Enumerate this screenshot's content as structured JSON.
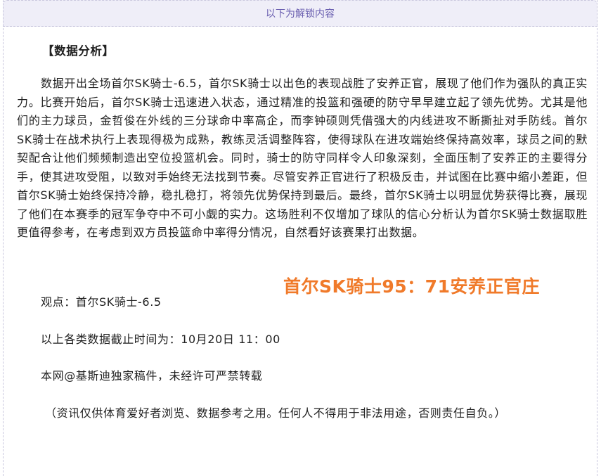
{
  "unlock_banner": {
    "text": "以下为解锁内容"
  },
  "article": {
    "heading": "【数据分析】",
    "body": "数据开出全场首尔SK骑士-6.5，首尔SK骑士以出色的表现战胜了安养正官，展现了他们作为强队的真正实力。比赛开始后，首尔SK骑士迅速进入状态，通过精准的投篮和强硬的防守早早建立起了领先优势。尤其是他们的主力球员，金哲俊在外线的三分球命中率高企，而李钟硕则凭借强大的内线进攻不断撕扯对手防线。首尔SK骑士在战术执行上表现得极为成熟，教练灵活调整阵容，使得球队在进攻端始终保持高效率，球员之间的默契配合让他们频频制造出空位投篮机会。同时，骑士的防守同样令人印象深刻，全面压制了安养正的主要得分手，使其进攻受阻，以致对手始终无法找到节奏。尽管安养正官进行了积极反击，并试图在比赛中缩小差距，但首尔SK骑士始终保持冷静，稳扎稳打，将领先优势保持到最后。最终，首尔SK骑士以明显优势获得比赛，展现了他们在本赛季的冠军争夺中不可小觑的实力。这场胜利不仅增加了球队的信心分析认为首尔SK骑士数据取胜更值得参考，在考虑到双方员投篮命中率得分情况，自然看好该赛果打出数据。",
    "viewpoint": "观点：首尔SK骑士-6.5",
    "cutoff": "以上各类数据截止时间为：10月20日 11：00",
    "copyright": "本网@基斯迪独家稿件，未经许可严禁转载",
    "disclaimer": "（资讯仅供体育爱好者浏览、数据参考之用。任何人不得用于非法用途，否则责任自负。）"
  },
  "score_overlay": {
    "text": "首尔SK骑士95：71安养正官庄",
    "color": "#f07a2a"
  }
}
